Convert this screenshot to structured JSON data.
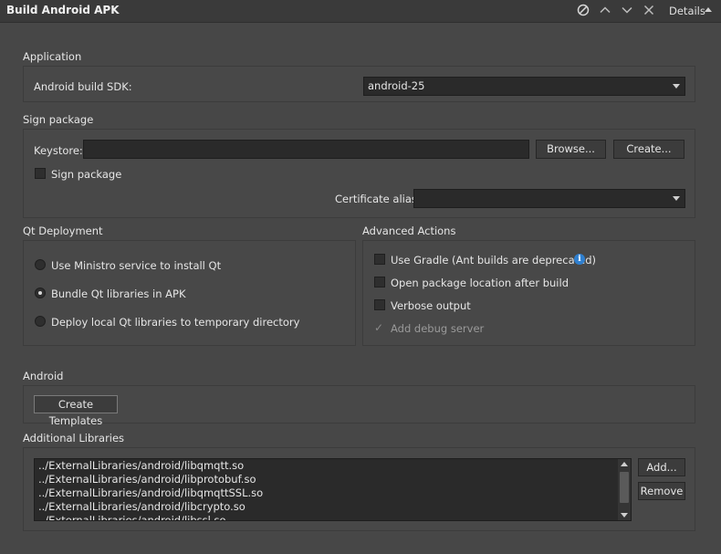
{
  "window": {
    "title": "Build Android APK",
    "details_label": "Details",
    "icons": [
      "disable-icon",
      "chevron-up-icon",
      "chevron-down-icon",
      "close-icon",
      "expand-arrow-icon"
    ]
  },
  "application": {
    "group_title": "Application",
    "sdk_label": "Android build SDK:",
    "sdk_value": "android-25"
  },
  "sign_package": {
    "group_title": "Sign package",
    "keystore_label": "Keystore:",
    "keystore_value": "",
    "browse_label": "Browse...",
    "create_label": "Create...",
    "sign_checkbox_label": "Sign package",
    "sign_checked": false,
    "certificate_alias_label": "Certificate alias:",
    "certificate_alias_value": ""
  },
  "qt_deployment": {
    "group_title": "Qt Deployment",
    "options": [
      {
        "label": "Use Ministro service to install Qt",
        "checked": false
      },
      {
        "label": "Bundle Qt libraries in APK",
        "checked": true
      },
      {
        "label": "Deploy local Qt libraries to temporary directory",
        "checked": false
      }
    ]
  },
  "advanced_actions": {
    "group_title": "Advanced Actions",
    "options": [
      {
        "label": "Use Gradle (Ant builds are deprecated)",
        "checked": false
      },
      {
        "label": "Open package location after build",
        "checked": false
      },
      {
        "label": "Verbose output",
        "checked": false
      },
      {
        "label": "Add debug server",
        "checked": true,
        "disabled": true
      }
    ],
    "info_icon": "info-icon"
  },
  "android": {
    "group_title": "Android",
    "create_templates_label": "Create Templates"
  },
  "additional_libraries": {
    "group_title": "Additional Libraries",
    "items": [
      "../ExternalLibraries/android/libqmqtt.so",
      "../ExternalLibraries/android/libprotobuf.so",
      "../ExternalLibraries/android/libqmqttSSL.so",
      "../ExternalLibraries/android/libcrypto.so",
      "../ExternalLibraries/android/libssl.so"
    ],
    "add_label": "Add...",
    "remove_label": "Remove"
  },
  "colors": {
    "background": "#474747",
    "input_background": "#2a2a2a",
    "info_blue": "#2f7fcf"
  }
}
